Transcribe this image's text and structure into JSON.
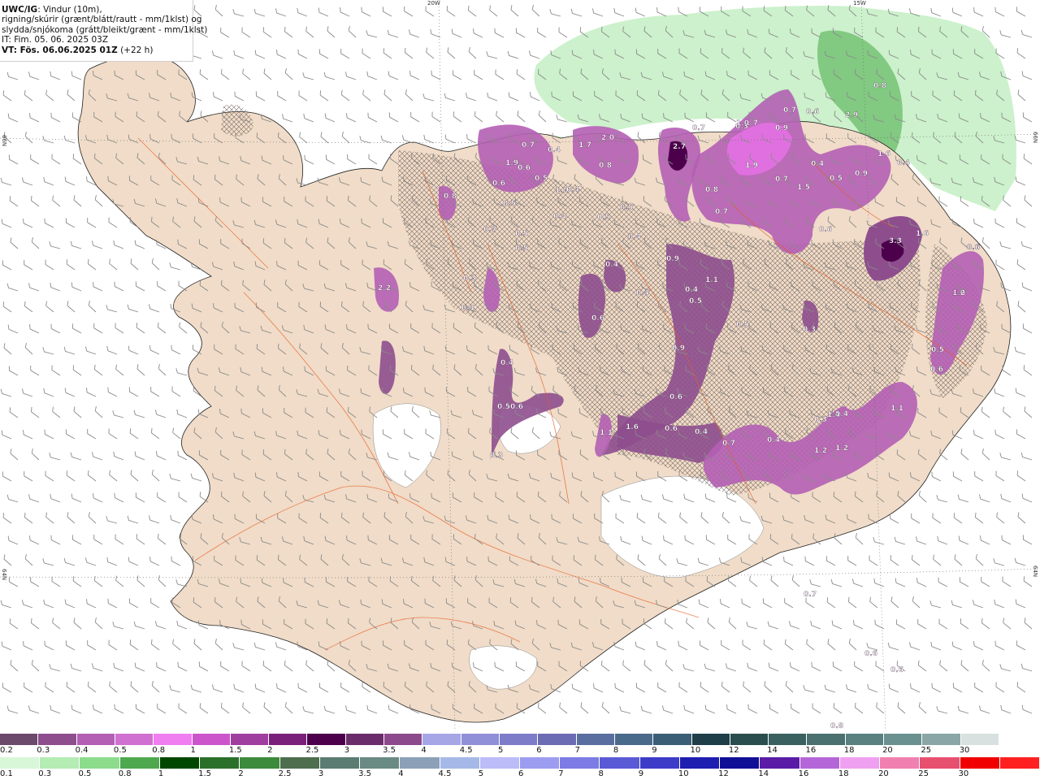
{
  "header": {
    "line1_bold": "UWC/IG",
    "line1_rest": ": Vindur (10m),",
    "line2": "rigning/skúrir (grænt/blátt/rautt - mm/1klst) og",
    "line3": "slydda/snjókoma (grátt/bleikt/grænt - mm/1klst)",
    "line4": "IT: Fim. 05. 06. 2025 03Z",
    "line5_bold": "VT: Fös. 06.06.2025 01Z",
    "line5_rest": " (+22 h)"
  },
  "lonlat_labels": {
    "top_20w": "20W",
    "top_15w": "15W",
    "left_66n": "66N",
    "left_64n": "64N",
    "right_66n": "66N",
    "right_64n": "64N"
  },
  "precip_values": [
    "2.7",
    "2.0",
    "1.7",
    "0.9",
    "0.7",
    "1.9",
    "0.7",
    "0.5",
    "0.9",
    "1.7",
    "0.8",
    "2.9",
    "0.8",
    "0.3",
    "0.7",
    "0.6",
    "1.6",
    "0.7",
    "0.4",
    "1.9",
    "0.6",
    "0.5",
    "0.6",
    "1.0",
    "0.4",
    "0.5",
    "0.8",
    "0.7",
    "1.5",
    "0.4",
    "0.6",
    "0.4",
    "0.5",
    "3.3",
    "1.6",
    "0.6",
    "0.8",
    "1.0",
    "0.7",
    "2.2",
    "0.5",
    "0.4",
    "0.5",
    "0.5",
    "0.4",
    "0.9",
    "0.4",
    "0.4",
    "1.1",
    "0.4",
    "0.3",
    "1.0",
    "0.6",
    "0.3",
    "0.4",
    "0.5",
    "0.5",
    "0.4",
    "0.5",
    "0.6",
    "0.9",
    "0.3",
    "0.6",
    "0.4",
    "0.3",
    "0.4",
    "1.4",
    "1.1",
    "1.1",
    "1.6",
    "0.6",
    "0.4",
    "0.7",
    "1.2",
    "1.2",
    "0.5",
    "1.2",
    "0.7",
    "0.6",
    "0.6",
    "0.8",
    "0.6",
    "0.6"
  ],
  "legend_snow": {
    "labels": [
      "0.2",
      "0.3",
      "0.4",
      "0.5",
      "0.8",
      "1",
      "1.5",
      "2",
      "2.5",
      "3",
      "3.5",
      "4",
      "4.5",
      "5",
      "6",
      "7",
      "8",
      "9",
      "10",
      "12",
      "14",
      "16",
      "18",
      "20",
      "25",
      "30"
    ],
    "colors": [
      "#6b4a6b",
      "#8e4e8e",
      "#b45fb4",
      "#d070d0",
      "#f07ef0",
      "#cc55cc",
      "#a03ea0",
      "#7a1f7a",
      "#4c004c",
      "#6a2c6a",
      "#8c4a8c",
      "#a6a6e6",
      "#9090d8",
      "#7c7cc8",
      "#6c6cb4",
      "#5a6fa0",
      "#4a6a8c",
      "#3a5e76",
      "#1e3e48",
      "#2a4e4e",
      "#3a6060",
      "#4a7070",
      "#5a8080",
      "#6a9090",
      "#8aa6a6",
      "#d8e0e0"
    ]
  },
  "legend_rain": {
    "labels": [
      "0.1",
      "0.3",
      "0.5",
      "0.8",
      "1",
      "1.5",
      "2",
      "2.5",
      "3",
      "3.5",
      "4",
      "4.5",
      "5",
      "6",
      "7",
      "8",
      "9",
      "10",
      "12",
      "14",
      "16",
      "18",
      "20",
      "25",
      "30"
    ],
    "colors": [
      "#d8f6d8",
      "#b4ecb4",
      "#8cdc8c",
      "#4ea84e",
      "#004800",
      "#2a702a",
      "#3c8a3c",
      "#4e6e4e",
      "#5a7c72",
      "#6a8a84",
      "#8ca0b8",
      "#a6b8e8",
      "#bcbcf8",
      "#9c9cf0",
      "#7c7ce4",
      "#5a5ad6",
      "#3c3cc8",
      "#1e1eb0",
      "#101096",
      "#5a1ca6",
      "#b466d8",
      "#f0a0f0",
      "#f080b0",
      "#e85070",
      "#f00000",
      "#ff2020"
    ]
  }
}
